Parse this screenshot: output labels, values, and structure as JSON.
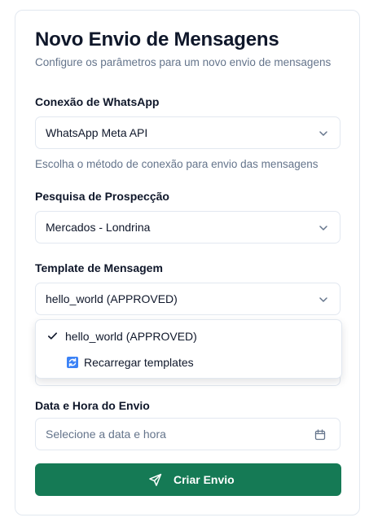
{
  "header": {
    "title": "Novo Envio de Mensagens",
    "subtitle": "Configure os parâmetros para um novo envio de mensagens"
  },
  "whatsapp_connection": {
    "label": "Conexão de WhatsApp",
    "value": "WhatsApp Meta API",
    "help": "Escolha o método de conexão para envio das mensagens"
  },
  "prospect_search": {
    "label": "Pesquisa de Prospecção",
    "value": "Mercados - Londrina"
  },
  "message_template": {
    "label": "Template de Mensagem",
    "value": "hello_world (APPROVED)",
    "options": [
      {
        "label": "hello_world (APPROVED)",
        "selected": true
      },
      {
        "label": "Recarregar templates",
        "icon": "reload-icon"
      }
    ]
  },
  "send_datetime": {
    "label": "Data e Hora do Envio",
    "placeholder": "Selecione a data e hora"
  },
  "submit": {
    "label": "Criar Envio"
  },
  "colors": {
    "primary": "#157a55",
    "border": "#e2e8f0",
    "muted": "#64748b"
  }
}
